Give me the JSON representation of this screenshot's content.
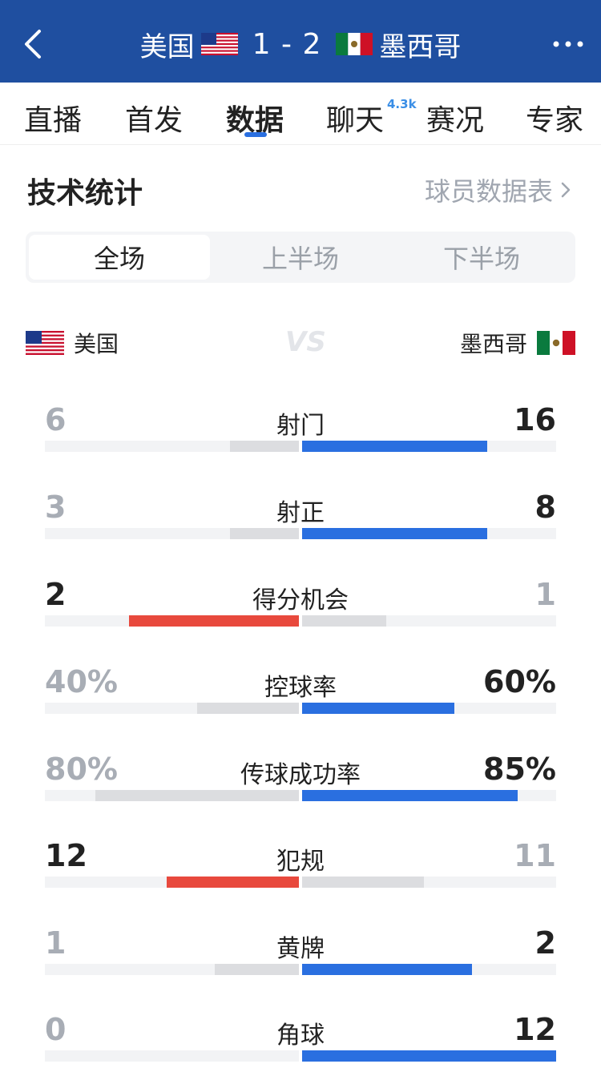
{
  "header": {
    "home_team": "美国",
    "away_team": "墨西哥",
    "score": "1 - 2",
    "back_icon": "chevron-left-icon",
    "more_icon": "more-horizontal-icon",
    "bg_color": "#1f4fa0"
  },
  "tabs": [
    {
      "label": "直播"
    },
    {
      "label": "首发"
    },
    {
      "label": "数据",
      "active": true
    },
    {
      "label": "聊天",
      "badge": "4.3k"
    },
    {
      "label": "赛况"
    },
    {
      "label": "专家"
    }
  ],
  "section": {
    "title": "技术统计",
    "link": "球员数据表"
  },
  "segments": [
    {
      "label": "全场",
      "active": true
    },
    {
      "label": "上半场"
    },
    {
      "label": "下半场"
    }
  ],
  "teams": {
    "left": "美国",
    "right": "墨西哥"
  },
  "colors": {
    "accent_blue": "#2a6fe0",
    "accent_red": "#e8493d",
    "neutral_bar": "#dcdde0",
    "track": "#f2f3f5"
  },
  "stats": [
    {
      "label": "射门",
      "left": "6",
      "right": "16",
      "left_frac": 0.27,
      "right_frac": 0.73,
      "leader": "right"
    },
    {
      "label": "射正",
      "left": "3",
      "right": "8",
      "left_frac": 0.27,
      "right_frac": 0.73,
      "leader": "right"
    },
    {
      "label": "得分机会",
      "left": "2",
      "right": "1",
      "left_frac": 0.67,
      "right_frac": 0.33,
      "leader": "left"
    },
    {
      "label": "控球率",
      "left": "40%",
      "right": "60%",
      "left_frac": 0.4,
      "right_frac": 0.6,
      "leader": "right"
    },
    {
      "label": "传球成功率",
      "left": "80%",
      "right": "85%",
      "left_frac": 0.8,
      "right_frac": 0.85,
      "leader": "right"
    },
    {
      "label": "犯规",
      "left": "12",
      "right": "11",
      "left_frac": 0.52,
      "right_frac": 0.48,
      "leader": "left"
    },
    {
      "label": "黄牌",
      "left": "1",
      "right": "2",
      "left_frac": 0.33,
      "right_frac": 0.67,
      "leader": "right"
    },
    {
      "label": "角球",
      "left": "0",
      "right": "12",
      "left_frac": 0.0,
      "right_frac": 1.0,
      "leader": "right"
    }
  ]
}
